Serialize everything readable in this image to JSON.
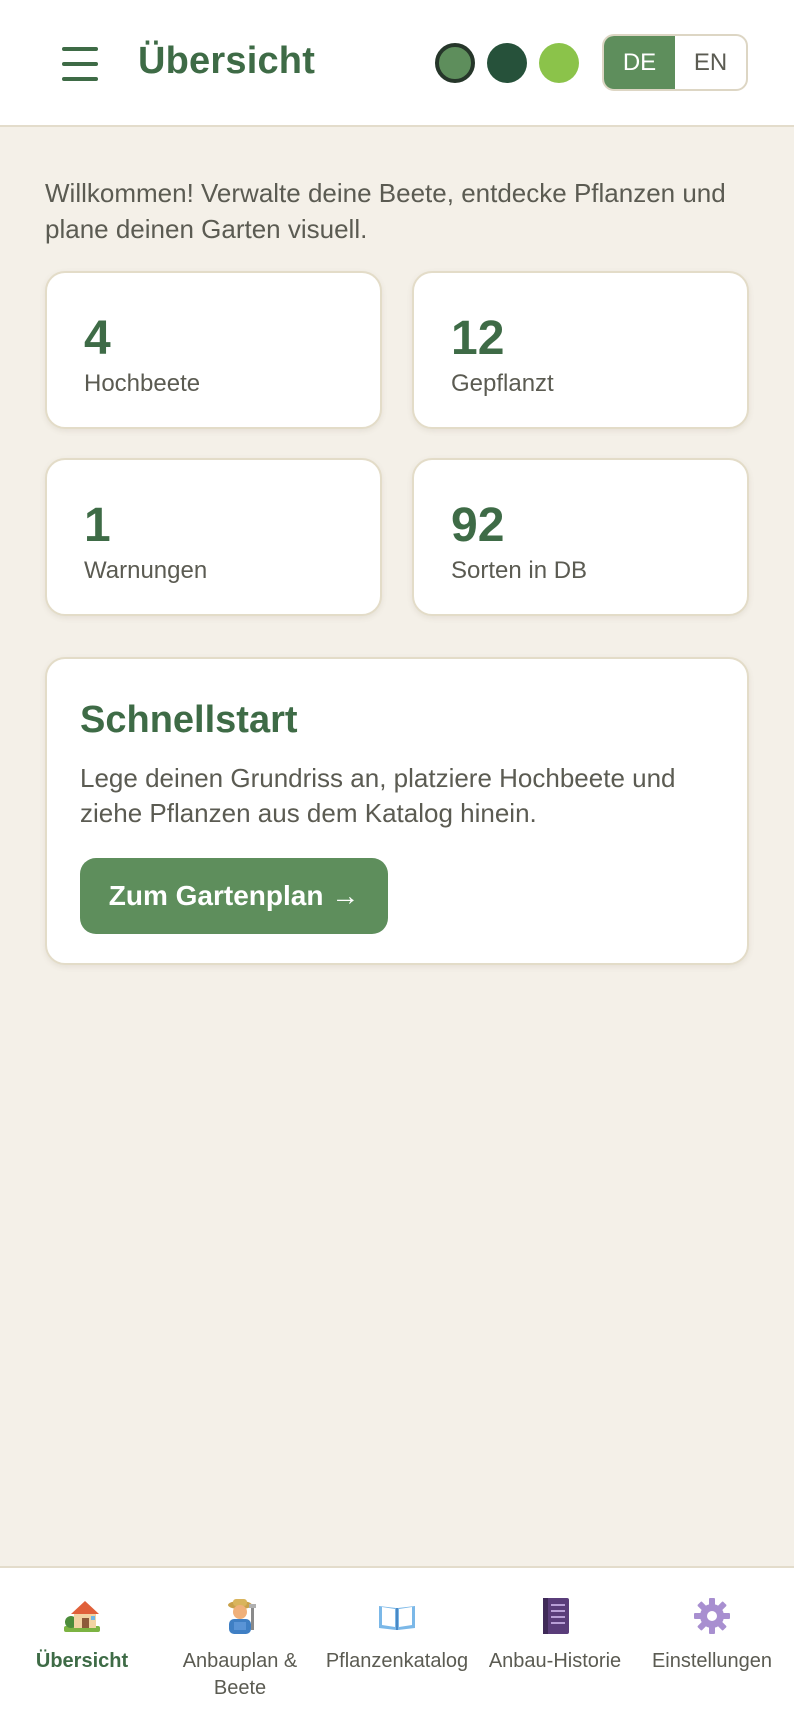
{
  "header": {
    "title": "Übersicht",
    "theme_colors": [
      "#5e8e5c",
      "#26513a",
      "#8bc34a"
    ],
    "languages": [
      "DE",
      "EN"
    ],
    "active_language": "DE"
  },
  "intro": "Willkommen! Verwalte deine Beete, entdecke Pflanzen und plane deinen Garten visuell.",
  "stats": [
    {
      "value": "4",
      "label": "Hochbeete"
    },
    {
      "value": "12",
      "label": "Gepflanzt"
    },
    {
      "value": "1",
      "label": "Warnungen"
    },
    {
      "value": "92",
      "label": "Sorten in DB"
    }
  ],
  "quickstart": {
    "title": "Schnellstart",
    "text": "Lege deinen Grundriss an, platziere Hochbeete und ziehe Pflanzen aus dem Katalog hinein.",
    "button": "Zum Gartenplan →"
  },
  "nav": {
    "items": [
      {
        "label": "Übersicht",
        "icon": "house-icon",
        "active": true
      },
      {
        "label": "Anbauplan & Beete",
        "icon": "farmer-icon",
        "active": false
      },
      {
        "label": "Pflanzenkatalog",
        "icon": "open-book-icon",
        "active": false
      },
      {
        "label": "Anbau-Historie",
        "icon": "notebook-icon",
        "active": false
      },
      {
        "label": "Einstellungen",
        "icon": "gear-icon",
        "active": false
      }
    ]
  },
  "colors": {
    "accent": "#3e6b46",
    "button": "#5e8e5c",
    "background": "#f4f0e8"
  }
}
